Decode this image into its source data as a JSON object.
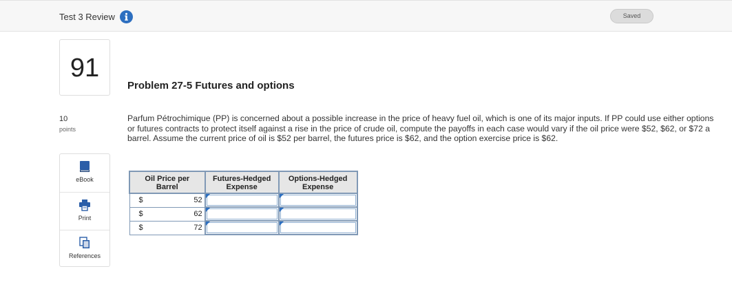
{
  "header": {
    "title": "Test 3 Review",
    "saved_label": "Saved"
  },
  "question": {
    "number": "91",
    "points_value": "10",
    "points_label": "points"
  },
  "tools": [
    {
      "label": "eBook",
      "icon": "book-icon"
    },
    {
      "label": "Print",
      "icon": "printer-icon"
    },
    {
      "label": "References",
      "icon": "references-icon"
    }
  ],
  "problem": {
    "title": "Problem 27-5 Futures and options",
    "text": "Parfum Pétrochimique (PP) is concerned about a possible increase in the price of heavy fuel oil, which is one of its major inputs. If PP could use either options or futures contracts to protect itself against a rise in the price of crude oil, compute the payoffs in each case would vary if the oil price were $52, $62, or $72 a barrel. Assume the current price of oil is $52 per barrel, the futures price is $62, and the option exercise price is $62."
  },
  "table": {
    "headers": [
      "Oil Price per Barrel",
      "Futures-Hedged Expense",
      "Options-Hedged Expense"
    ],
    "rows": [
      {
        "currency": "$",
        "price": "52",
        "futures": "",
        "options": ""
      },
      {
        "currency": "$",
        "price": "62",
        "futures": "",
        "options": ""
      },
      {
        "currency": "$",
        "price": "72",
        "futures": "",
        "options": ""
      }
    ]
  },
  "colors": {
    "accent": "#2d6fc0",
    "table_border": "#7f98b5",
    "header_bg": "#e6e6e6"
  }
}
